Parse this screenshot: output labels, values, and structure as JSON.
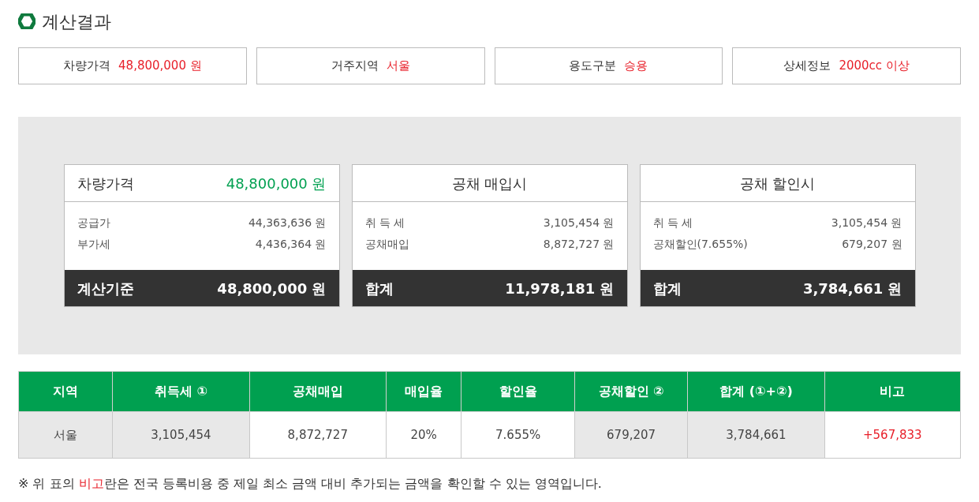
{
  "title": "계산결과",
  "summary": [
    {
      "label": "차량가격",
      "value": "48,800,000 원"
    },
    {
      "label": "거주지역",
      "value": "서울"
    },
    {
      "label": "용도구분",
      "value": "승용"
    },
    {
      "label": "상세정보",
      "value": "2000cc 이상"
    }
  ],
  "cards": [
    {
      "kind": "price",
      "title": "차량가격",
      "value": "48,800,000 원",
      "rows": [
        {
          "label": "공급가",
          "value": "44,363,636 원"
        },
        {
          "label": "부가세",
          "value": "4,436,364 원"
        }
      ],
      "total_label": "계산기준",
      "total_value": "48,800,000 원"
    },
    {
      "kind": "title",
      "title": "공채 매입시",
      "rows": [
        {
          "label": "취 득 세",
          "value": "3,105,454 원"
        },
        {
          "label": "공채매입",
          "value": "8,872,727 원"
        }
      ],
      "total_label": "합계",
      "total_value": "11,978,181 원"
    },
    {
      "kind": "title",
      "title": "공채 할인시",
      "rows": [
        {
          "label": "취 득 세",
          "value": "3,105,454 원"
        },
        {
          "label": "공채할인(7.655%)",
          "value": "679,207 원"
        }
      ],
      "total_label": "합계",
      "total_value": "3,784,661 원"
    }
  ],
  "table": {
    "columns": [
      "지역",
      "취득세 ①",
      "공채매입",
      "매입율",
      "할인율",
      "공채할인 ②",
      "합계 (①+②)",
      "비고"
    ],
    "rows": [
      [
        {
          "text": "서울",
          "highlighted": true,
          "kind": "plain"
        },
        {
          "text": "3,105,454",
          "highlighted": true,
          "kind": "plain"
        },
        {
          "text": "8,872,727",
          "highlighted": false,
          "kind": "plain"
        },
        {
          "text": "20%",
          "highlighted": false,
          "kind": "plain"
        },
        {
          "text": "7.655%",
          "highlighted": false,
          "kind": "plain"
        },
        {
          "text": "679,207",
          "highlighted": true,
          "kind": "plain"
        },
        {
          "text": "3,784,661",
          "highlighted": true,
          "kind": "plain"
        },
        {
          "text": "+567,833",
          "highlighted": false,
          "kind": "difference"
        }
      ]
    ]
  },
  "note": {
    "before": "※ 위 표의 ",
    "highlight": "비고",
    "after": "란은 전국 등록비용 중 제일 최소 금액 대비 추가되는 금액을 확인할 수 있는 영역입니다."
  }
}
